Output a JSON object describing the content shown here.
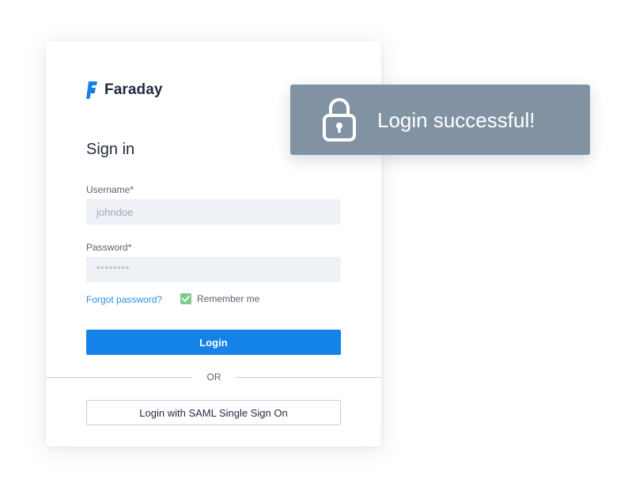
{
  "brand": {
    "name": "Faraday",
    "color": "#1383e8"
  },
  "form": {
    "title": "Sign in",
    "username": {
      "label": "Username*",
      "placeholder": "johndoe"
    },
    "password": {
      "label": "Password*",
      "placeholder": "********"
    },
    "forgot_password": "Forgot password?",
    "remember_me": {
      "label": "Remember me",
      "checked": true
    },
    "login_button": "Login",
    "divider_text": "OR",
    "saml_button": "Login with SAML Single Sign On"
  },
  "toast": {
    "message": "Login successful!",
    "icon": "lock-icon",
    "background": "#8193a3"
  }
}
